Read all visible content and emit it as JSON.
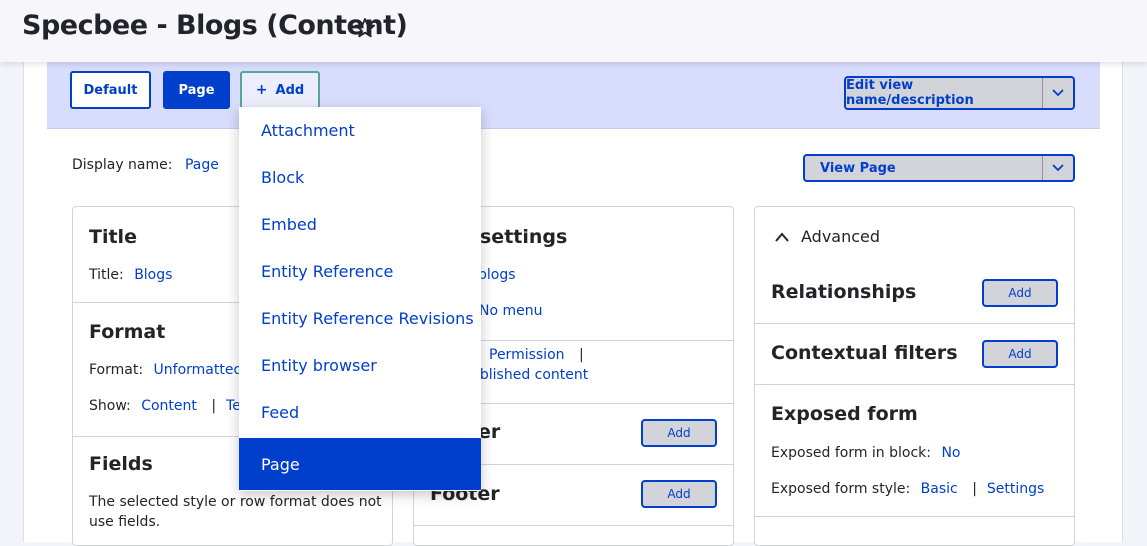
{
  "header": {
    "title": "Specbee - Blogs (Content)",
    "star_icon": "star-outline-icon"
  },
  "tabs": {
    "default_label": "Default",
    "page_label": "Page",
    "add_label": "Add",
    "add_icon": "plus-icon"
  },
  "edit_button": {
    "label": "Edit view name/description",
    "arrow_icon": "chevron-down-icon"
  },
  "view_button": {
    "label": "View Page",
    "arrow_icon": "chevron-down-icon"
  },
  "display_name": {
    "label": "Display name:",
    "value": "Page"
  },
  "column1": {
    "title_section": {
      "heading": "Title",
      "label": "Title:",
      "value": "Blogs"
    },
    "format_section": {
      "heading": "Format",
      "format_label": "Format:",
      "format_value": "Unformatted l",
      "show_label": "Show:",
      "show_value": "Content",
      "separator": "|",
      "show_value2": "Tea"
    },
    "fields_section": {
      "heading": "Fields",
      "text": "The selected style or row format does not",
      "text2": "use fields."
    }
  },
  "column2": {
    "settings_heading": "settings",
    "path_value": "blogs",
    "menu_value": "No menu",
    "access_value": "Permission",
    "access_separator": "|",
    "published_value": "ublished content",
    "header_heading": "er",
    "footer_heading": "Footer",
    "add_label": "Add"
  },
  "column3": {
    "advanced_label": "Advanced",
    "advanced_icon": "chevron-up-icon",
    "relationships_heading": "Relationships",
    "contextual_heading": "Contextual filters",
    "add_label": "Add",
    "exposed_form": {
      "heading": "Exposed form",
      "block_label": "Exposed form in block:",
      "block_value": "No",
      "style_label": "Exposed form style:",
      "style_value": "Basic",
      "separator": "|",
      "settings_value": "Settings"
    }
  },
  "dropdown": {
    "items": [
      {
        "label": "Attachment"
      },
      {
        "label": "Block"
      },
      {
        "label": "Embed"
      },
      {
        "label": "Entity Reference"
      },
      {
        "label": "Entity Reference Revisions"
      },
      {
        "label": "Entity browser"
      },
      {
        "label": "Feed"
      },
      {
        "label": "Page"
      }
    ],
    "active_index": 7
  },
  "colors": {
    "accent": "#003ecc",
    "tab_bar": "#d8dcfd",
    "button_gray": "#d3d4d9"
  }
}
